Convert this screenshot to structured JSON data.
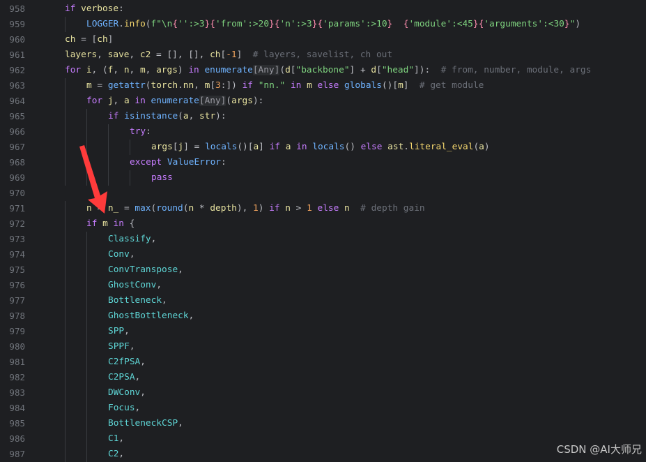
{
  "lines": [
    {
      "no": "958",
      "indent": 1,
      "code": [
        [
          "kw",
          "if "
        ],
        [
          "id",
          "verbose"
        ],
        [
          "b",
          ":"
        ]
      ]
    },
    {
      "no": "959",
      "indent": 2,
      "code": [
        [
          "blu",
          "LOGGER"
        ],
        [
          "b",
          "."
        ],
        [
          "yl",
          "info"
        ],
        [
          "b",
          "("
        ],
        [
          "gr",
          "f\"\\n"
        ],
        [
          "pk",
          "{"
        ],
        [
          "gr",
          "'':>3"
        ],
        [
          "pk",
          "}{"
        ],
        [
          "gr",
          "'from':>20"
        ],
        [
          "pk",
          "}{"
        ],
        [
          "gr",
          "'n':>3"
        ],
        [
          "pk",
          "}{"
        ],
        [
          "gr",
          "'params':>10"
        ],
        [
          "pk",
          "}"
        ],
        [
          "gr",
          "  "
        ],
        [
          "pk",
          "{"
        ],
        [
          "gr",
          "'module':<45"
        ],
        [
          "pk",
          "}{"
        ],
        [
          "gr",
          "'arguments':<30"
        ],
        [
          "pk",
          "}"
        ],
        [
          "gr",
          "\""
        ],
        [
          "b",
          ")"
        ]
      ]
    },
    {
      "no": "960",
      "indent": 1,
      "code": [
        [
          "id",
          "ch "
        ],
        [
          "b",
          "= ["
        ],
        [
          "id",
          "ch"
        ],
        [
          "b",
          "]"
        ]
      ]
    },
    {
      "no": "961",
      "indent": 1,
      "code": [
        [
          "id",
          "layers"
        ],
        [
          "b",
          ", "
        ],
        [
          "id",
          "save"
        ],
        [
          "b",
          ", "
        ],
        [
          "id",
          "c2 "
        ],
        [
          "b",
          "= [], [], "
        ],
        [
          "id",
          "ch"
        ],
        [
          "b",
          "["
        ],
        [
          "lit",
          "-1"
        ],
        [
          "b",
          "]  "
        ],
        [
          "cm",
          "# layers, savelist, ch out"
        ]
      ]
    },
    {
      "no": "962",
      "indent": 1,
      "code": [
        [
          "kw",
          "for "
        ],
        [
          "id",
          "i"
        ],
        [
          "b",
          ", ("
        ],
        [
          "id",
          "f"
        ],
        [
          "b",
          ", "
        ],
        [
          "id",
          "n"
        ],
        [
          "b",
          ", "
        ],
        [
          "id",
          "m"
        ],
        [
          "b",
          ", "
        ],
        [
          "id",
          "args"
        ],
        [
          "b",
          ") "
        ],
        [
          "kw",
          "in "
        ],
        [
          "blu",
          "enumerate"
        ],
        [
          "typ",
          "[Any]"
        ],
        [
          "b",
          "("
        ],
        [
          "id",
          "d"
        ],
        [
          "b",
          "["
        ],
        [
          "gr",
          "\"backbone\""
        ],
        [
          "b",
          "] + "
        ],
        [
          "id",
          "d"
        ],
        [
          "b",
          "["
        ],
        [
          "gr",
          "\"head\""
        ],
        [
          "b",
          "]):  "
        ],
        [
          "cm",
          "# from, number, module, args"
        ]
      ]
    },
    {
      "no": "963",
      "indent": 2,
      "code": [
        [
          "id",
          "m "
        ],
        [
          "b",
          "= "
        ],
        [
          "blu",
          "getattr"
        ],
        [
          "b",
          "("
        ],
        [
          "id",
          "torch"
        ],
        [
          "b",
          "."
        ],
        [
          "id",
          "nn"
        ],
        [
          "b",
          ", "
        ],
        [
          "id",
          "m"
        ],
        [
          "b",
          "["
        ],
        [
          "lit",
          "3"
        ],
        [
          "b",
          ":]) "
        ],
        [
          "kw",
          "if "
        ],
        [
          "gr",
          "\"nn.\" "
        ],
        [
          "kw",
          "in "
        ],
        [
          "id",
          "m "
        ],
        [
          "kw",
          "else "
        ],
        [
          "blu",
          "globals"
        ],
        [
          "b",
          "()["
        ],
        [
          "id",
          "m"
        ],
        [
          "b",
          "]  "
        ],
        [
          "cm",
          "# get module"
        ]
      ]
    },
    {
      "no": "964",
      "indent": 2,
      "code": [
        [
          "kw",
          "for "
        ],
        [
          "id",
          "j"
        ],
        [
          "b",
          ", "
        ],
        [
          "id",
          "a "
        ],
        [
          "kw",
          "in "
        ],
        [
          "blu",
          "enumerate"
        ],
        [
          "typ",
          "[Any]"
        ],
        [
          "b",
          "("
        ],
        [
          "id",
          "args"
        ],
        [
          "b",
          "):"
        ]
      ]
    },
    {
      "no": "965",
      "indent": 3,
      "code": [
        [
          "kw",
          "if "
        ],
        [
          "blu",
          "isinstance"
        ],
        [
          "b",
          "("
        ],
        [
          "id",
          "a"
        ],
        [
          "b",
          ", "
        ],
        [
          "id",
          "str"
        ],
        [
          "b",
          "):"
        ]
      ]
    },
    {
      "no": "966",
      "indent": 4,
      "code": [
        [
          "kw",
          "try"
        ],
        [
          "b",
          ":"
        ]
      ]
    },
    {
      "no": "967",
      "indent": 5,
      "code": [
        [
          "id",
          "args"
        ],
        [
          "b",
          "["
        ],
        [
          "id",
          "j"
        ],
        [
          "b",
          "] = "
        ],
        [
          "blu",
          "locals"
        ],
        [
          "b",
          "()["
        ],
        [
          "id",
          "a"
        ],
        [
          "b",
          "] "
        ],
        [
          "kw",
          "if "
        ],
        [
          "id",
          "a "
        ],
        [
          "kw",
          "in "
        ],
        [
          "blu",
          "locals"
        ],
        [
          "b",
          "() "
        ],
        [
          "kw",
          "else "
        ],
        [
          "id",
          "ast"
        ],
        [
          "b",
          "."
        ],
        [
          "yl",
          "literal_eval"
        ],
        [
          "b",
          "("
        ],
        [
          "id",
          "a"
        ],
        [
          "b",
          ")"
        ]
      ]
    },
    {
      "no": "968",
      "indent": 4,
      "code": [
        [
          "kw",
          "except "
        ],
        [
          "blu",
          "ValueError"
        ],
        [
          "b",
          ":"
        ]
      ]
    },
    {
      "no": "969",
      "indent": 5,
      "code": [
        [
          "kw",
          "pass"
        ]
      ]
    },
    {
      "no": "970",
      "indent": 0,
      "code": []
    },
    {
      "no": "971",
      "indent": 2,
      "code": [
        [
          "id",
          "n "
        ],
        [
          "b",
          "= "
        ],
        [
          "id",
          "n_ "
        ],
        [
          "b",
          "= "
        ],
        [
          "blu",
          "max"
        ],
        [
          "b",
          "("
        ],
        [
          "blu",
          "round"
        ],
        [
          "b",
          "("
        ],
        [
          "id",
          "n "
        ],
        [
          "b",
          "* "
        ],
        [
          "id",
          "depth"
        ],
        [
          "b",
          "), "
        ],
        [
          "lit",
          "1"
        ],
        [
          "b",
          ") "
        ],
        [
          "kw",
          "if "
        ],
        [
          "id",
          "n "
        ],
        [
          "b",
          "> "
        ],
        [
          "lit",
          "1 "
        ],
        [
          "kw",
          "else "
        ],
        [
          "id",
          "n  "
        ],
        [
          "cm",
          "# depth gain"
        ]
      ]
    },
    {
      "no": "972",
      "indent": 2,
      "code": [
        [
          "kw",
          "if "
        ],
        [
          "id",
          "m "
        ],
        [
          "kw",
          "in "
        ],
        [
          "b",
          "{"
        ]
      ]
    },
    {
      "no": "973",
      "indent": 3,
      "code": [
        [
          "cy",
          "Classify"
        ],
        [
          "b",
          ","
        ]
      ]
    },
    {
      "no": "974",
      "indent": 3,
      "code": [
        [
          "cy",
          "Conv"
        ],
        [
          "b",
          ","
        ]
      ]
    },
    {
      "no": "975",
      "indent": 3,
      "code": [
        [
          "cy",
          "ConvTranspose"
        ],
        [
          "b",
          ","
        ]
      ]
    },
    {
      "no": "976",
      "indent": 3,
      "code": [
        [
          "cy",
          "GhostConv"
        ],
        [
          "b",
          ","
        ]
      ]
    },
    {
      "no": "977",
      "indent": 3,
      "code": [
        [
          "cy",
          "Bottleneck"
        ],
        [
          "b",
          ","
        ]
      ]
    },
    {
      "no": "978",
      "indent": 3,
      "code": [
        [
          "cy",
          "GhostBottleneck"
        ],
        [
          "b",
          ","
        ]
      ]
    },
    {
      "no": "979",
      "indent": 3,
      "code": [
        [
          "cy",
          "SPP"
        ],
        [
          "b",
          ","
        ]
      ]
    },
    {
      "no": "980",
      "indent": 3,
      "code": [
        [
          "cy",
          "SPPF"
        ],
        [
          "b",
          ","
        ]
      ]
    },
    {
      "no": "981",
      "indent": 3,
      "code": [
        [
          "cy",
          "C2fPSA"
        ],
        [
          "b",
          ","
        ]
      ]
    },
    {
      "no": "982",
      "indent": 3,
      "code": [
        [
          "cy",
          "C2PSA"
        ],
        [
          "b",
          ","
        ]
      ]
    },
    {
      "no": "983",
      "indent": 3,
      "code": [
        [
          "cy",
          "DWConv"
        ],
        [
          "b",
          ","
        ]
      ]
    },
    {
      "no": "984",
      "indent": 3,
      "code": [
        [
          "cy",
          "Focus"
        ],
        [
          "b",
          ","
        ]
      ]
    },
    {
      "no": "985",
      "indent": 3,
      "code": [
        [
          "cy",
          "BottleneckCSP"
        ],
        [
          "b",
          ","
        ]
      ]
    },
    {
      "no": "986",
      "indent": 3,
      "code": [
        [
          "cy",
          "C1"
        ],
        [
          "b",
          ","
        ]
      ]
    },
    {
      "no": "987",
      "indent": 3,
      "code": [
        [
          "cy",
          "C2"
        ],
        [
          "b",
          ","
        ]
      ]
    }
  ],
  "watermark": "CSDN @AI大师兄",
  "arrow_color": "#ff3b3b"
}
